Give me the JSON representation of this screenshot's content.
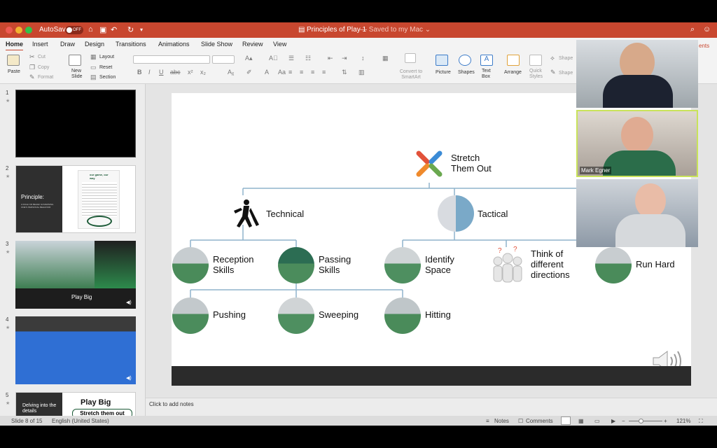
{
  "titlebar": {
    "autosave": "AutoSave",
    "toggle": "OFF",
    "doc_title": "Principles of Play 1",
    "saved": "— Saved to my Mac ⌄"
  },
  "tabs": [
    "Home",
    "Insert",
    "Draw",
    "Design",
    "Transitions",
    "Animations",
    "Slide Show",
    "Review",
    "View"
  ],
  "ribbon": {
    "paste": "Paste",
    "cut": "Cut",
    "copy": "Copy",
    "format": "Format",
    "new_slide": "New Slide",
    "layout": "Layout",
    "reset": "Reset",
    "section": "Section",
    "convert": "Convert to SmartArt",
    "picture": "Picture",
    "shapes": "Shapes",
    "textbox": "Text Box",
    "arrange": "Arrange",
    "quick_styles": "Quick Styles",
    "shape1": "Shape",
    "shape2": "Shape",
    "comments_stub": "ents"
  },
  "slides": [
    {
      "num": "1"
    },
    {
      "num": "2",
      "principle": "Principle:",
      "caption": "A RULE OR BELIEF GOVERNING ONE'S PERSONAL BEHAVIOR",
      "poster_title": "our game, our way"
    },
    {
      "num": "3",
      "label": "Play Big"
    },
    {
      "num": "4"
    },
    {
      "num": "5",
      "left": "Delving into the details",
      "right1": "Play Big",
      "right2": "Stretch them out"
    }
  ],
  "main_slide": {
    "root": "Stretch\nThem Out",
    "technical": "Technical",
    "tactical": "Tactical",
    "reception": "Reception\nSkills",
    "passing": "Passing\nSkills",
    "identify": "Identify\nSpace",
    "think": "Think of\ndifferent\ndirections",
    "run": "Run Hard",
    "pushing": "Pushing",
    "sweeping": "Sweeping",
    "hitting": "Hitting"
  },
  "notes_placeholder": "Click to add notes",
  "status": {
    "slide": "Slide 8 of 15",
    "lang": "English (United States)",
    "notes": "Notes",
    "comments": "Comments",
    "zoom": "121%"
  },
  "video": {
    "participant2": "Mark Egner"
  },
  "colors": {
    "accent": "#c8472f",
    "connector": "#8fb3cc",
    "turf": "#2e7d4f"
  }
}
